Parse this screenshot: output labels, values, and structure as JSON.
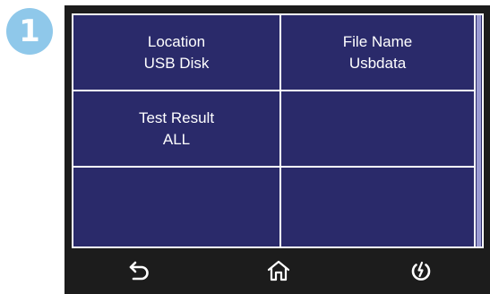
{
  "step_badge": "1",
  "grid": {
    "location": {
      "label": "Location",
      "value": "USB Disk"
    },
    "file_name": {
      "label": "File Name",
      "value": "Usbdata"
    },
    "test_result": {
      "label": "Test Result",
      "value": "ALL"
    }
  },
  "icons": {
    "back": "back-arrow-icon",
    "home": "home-icon",
    "power": "power-icon"
  },
  "colors": {
    "cell_bg": "#2a2a6a",
    "grid_lines": "#ffffff",
    "bar_bg": "#1c1c1c",
    "badge": "#8fc8ea",
    "scroll_thumb": "#9c9cd2"
  }
}
